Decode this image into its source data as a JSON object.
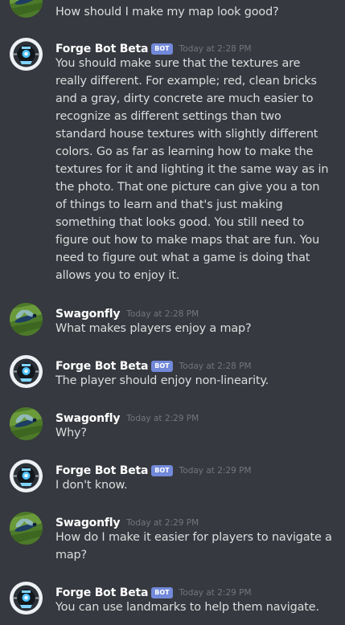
{
  "messages": [
    {
      "author": "",
      "bot": false,
      "time": "",
      "avatar": "swagonfly-avatar",
      "text": "How should I make my map look good?"
    },
    {
      "author": "Forge Bot Beta",
      "bot": true,
      "badge": "BOT",
      "time": "Today at 2:28 PM",
      "avatar": "forge-bot-avatar",
      "text": "You should make sure that the textures are really different. For example; red, clean bricks and a gray, dirty concrete are much easier to recognize as different settings than two standard house textures with slightly different colors. Go as far as learning how to make the textures for it and lighting it the same way as in the photo. That one picture can give you a ton of things to learn and that's just making something that looks good. You still need to figure out how to make maps that are fun. You need to figure out what a game is doing that allows you to enjoy it."
    },
    {
      "author": "Swagonfly",
      "bot": false,
      "time": "Today at 2:28 PM",
      "avatar": "swagonfly-avatar",
      "text": "What makes players enjoy a map?"
    },
    {
      "author": "Forge Bot Beta",
      "bot": true,
      "badge": "BOT",
      "time": "Today at 2:28 PM",
      "avatar": "forge-bot-avatar",
      "text": "The player should enjoy non-linearity."
    },
    {
      "author": "Swagonfly",
      "bot": false,
      "time": "Today at 2:29 PM",
      "avatar": "swagonfly-avatar",
      "text": "Why?"
    },
    {
      "author": "Forge Bot Beta",
      "bot": true,
      "badge": "BOT",
      "time": "Today at 2:29 PM",
      "avatar": "forge-bot-avatar",
      "text": "I don't know."
    },
    {
      "author": "Swagonfly",
      "bot": false,
      "time": "Today at 2:29 PM",
      "avatar": "swagonfly-avatar",
      "text": "How do I make it easier for players to navigate a map?"
    },
    {
      "author": "Forge Bot Beta",
      "bot": true,
      "badge": "BOT",
      "time": "Today at 2:29 PM",
      "avatar": "forge-bot-avatar",
      "text": "You can use landmarks to help them navigate."
    }
  ]
}
